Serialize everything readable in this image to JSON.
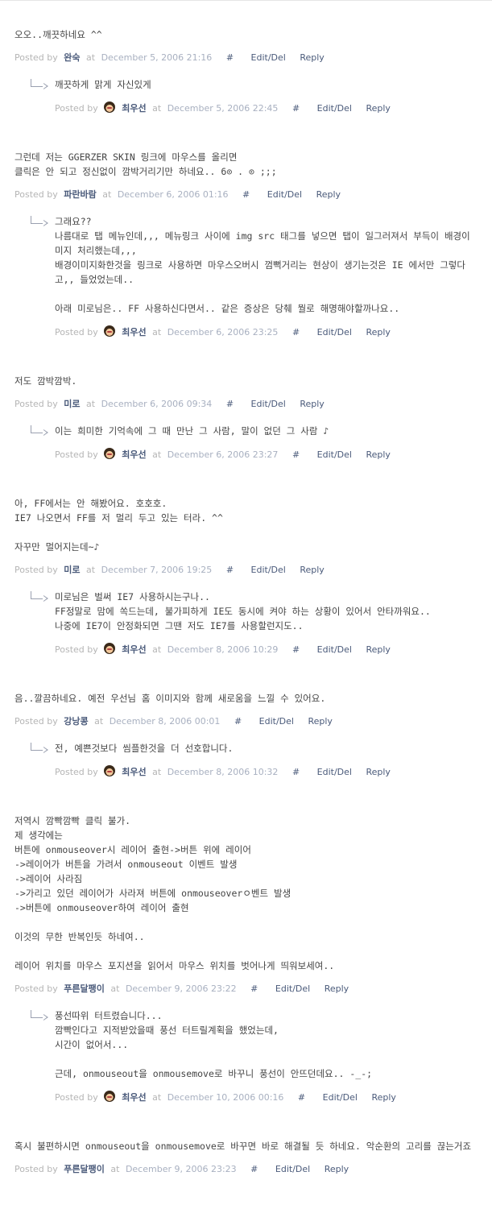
{
  "labels": {
    "posted_by": "Posted by",
    "at": "at",
    "hash": "#",
    "edit_del": "Edit/Del",
    "reply": "Reply"
  },
  "comments": [
    {
      "text": "오오..깨끗하네요 ^^",
      "author": "완숙",
      "date": "December 5, 2006 21:16",
      "reply": {
        "text": "깨끗하게 맑게 자신있게",
        "author": "최우선",
        "date": "December 5, 2006 22:45"
      }
    },
    {
      "text": "그런데 저는 GGERZER SKIN 링크에 마우스를 올리면\n클릭은 안 되고 정신없이 깜박거리기만 하네요.. 6⊙ . ⊙ ;;;",
      "author": "파란바람",
      "date": "December 6, 2006 01:16",
      "reply": {
        "text": "그래요??\n나름대로 탭 메뉴인데,,, 메뉴링크 사이에 img src 태그를 넣으면 탭이 일그러져서 부득이 배경이미지 처리했는데,,,\n배경이미지화한것을 링크로 사용하면 마우스오버시 껌뻑거리는 현상이 생기는것은 IE 에서만 그렇다고,, 들었었는데..\n\n아래 미로님은.. FF 사용하신다면서.. 같은 증상은 당췌 뭘로 해명해야할까나요..",
        "author": "최우선",
        "date": "December 6, 2006 23:25"
      }
    },
    {
      "text": "저도 깜박깜박.",
      "author": "미로",
      "date": "December 6, 2006 09:34",
      "reply": {
        "text": "이는 희미한 기억속에 그 때 만난 그 사람, 말이 없던 그 사람 ♪",
        "author": "최우선",
        "date": "December 6, 2006 23:27"
      }
    },
    {
      "text": "아, FF에서는 안 해봤어요. 호호호.\nIE7 나오면서 FF를 저 멀리 두고 있는 터라. ^^\n\n자꾸만 멀어지는데~♪",
      "author": "미로",
      "date": "December 7, 2006 19:25",
      "reply": {
        "text": "미로님은 벌써 IE7 사용하시는구나..\nFF정말로 맘에 쏙드는데, 불가피하게 IE도 동시에 켜야 하는 상황이 있어서 안타까워요..\n나중에 IE7이 안정화되면 그땐 저도 IE7를 사용할런지도..",
        "author": "최우선",
        "date": "December 8, 2006 10:29"
      }
    },
    {
      "text": "음..깔끔하네요. 예전 우선님 홈 이미지와 함께 새로움을 느낄 수 있어요.",
      "author": "강낭콩",
      "date": "December 8, 2006 00:01",
      "reply": {
        "text": "전, 예쁜것보다 씸플한것을 더 선호합니다.",
        "author": "최우선",
        "date": "December 8, 2006 10:32"
      }
    },
    {
      "text": "저역시 깜빡깜빡 클릭 불가.\n제 생각에는\n버튼에 onmouseover시 레이어 출현->버튼 위에 레이어\n->레이어가 버튼을 가려서 onmouseout 이벤트 발생\n->레이어 사라짐\n->가리고 있던 레이어가 사라져 버튼에 onmouseoverㅇ벤트 발생\n->버튼에 onmouseover하여 레이어 출현\n\n이것의 무한 반복인듯 하네여..\n\n레이어 위치를 마우스 포지션을 읽어서 마우스 위치를 벗어나게 띄워보세여..",
      "author": "푸른달팽이",
      "date": "December 9, 2006 23:22",
      "reply": {
        "text": "풍선따위 터트렸습니다...\n깜빡인다고 지적받았을때 풍선 터트릴계획을 했었는데,\n시간이 없어서...\n\n근데, onmouseout을 onmousemove로 바꾸니 풍선이 안뜨던데요.. -_-;",
        "author": "최우선",
        "date": "December 10, 2006 00:16"
      }
    },
    {
      "text": "혹시 불편하시면 onmouseout을 onmousemove로 바꾸면 바로 해결될 듯 하네요. 악순환의 고리를 끊는거죠",
      "author": "푸른달팽이",
      "date": "December 9, 2006 23:23"
    }
  ]
}
